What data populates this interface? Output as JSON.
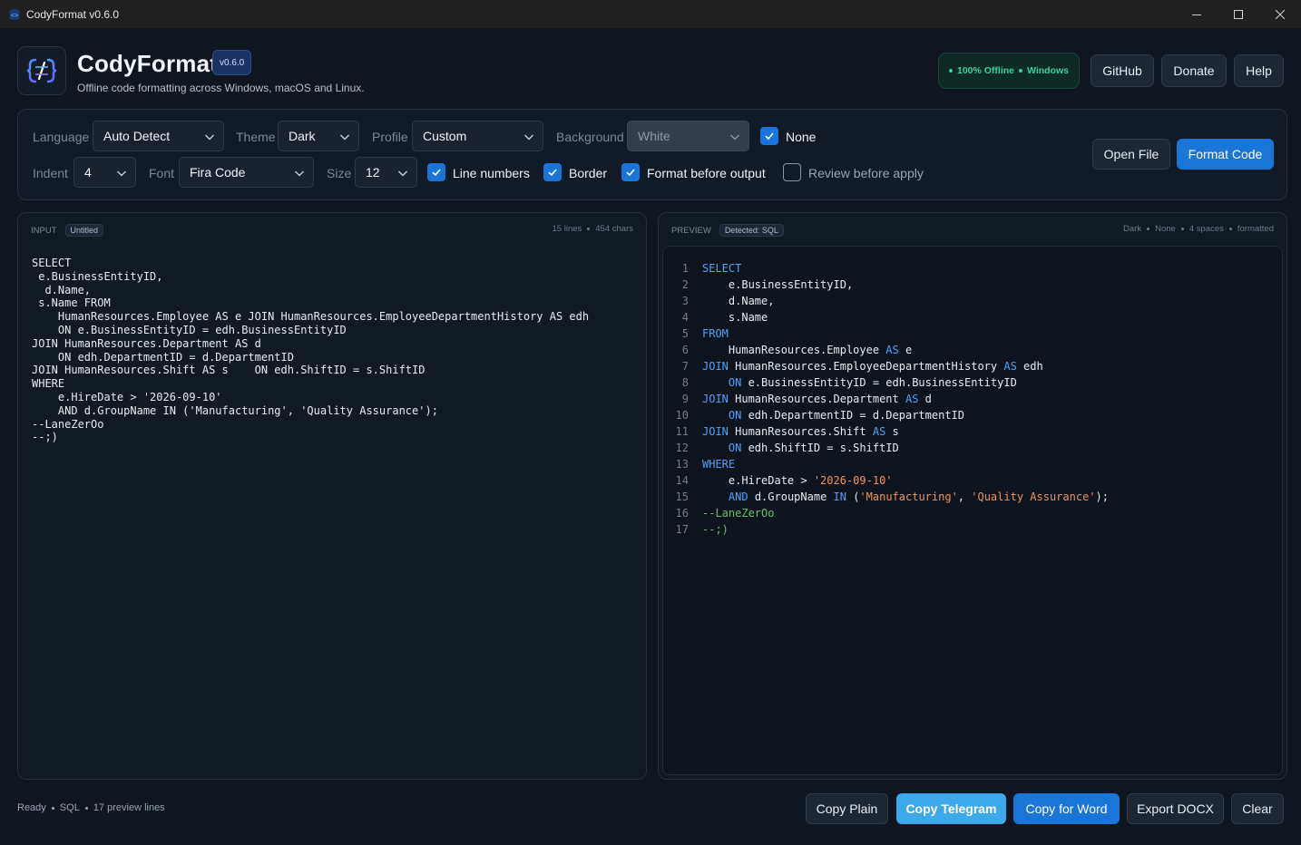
{
  "window": {
    "title": "CodyFormat v0.6.0"
  },
  "header": {
    "brand": "CodyFormat",
    "version": "v0.6.0",
    "subtitle": "Offline code formatting across Windows, macOS and Linux.",
    "status_offline": "100% Offline",
    "status_os": "Windows",
    "buttons": {
      "github": "GitHub",
      "donate": "Donate",
      "help": "Help"
    }
  },
  "options": {
    "language_label": "Language",
    "language_value": "Auto Detect",
    "theme_label": "Theme",
    "theme_value": "Dark",
    "profile_label": "Profile",
    "profile_value": "Custom",
    "background_label": "Background",
    "background_value": "White",
    "none_label": "None",
    "none_checked": true,
    "indent_label": "Indent",
    "indent_value": "4",
    "font_label": "Font",
    "font_value": "Fira Code",
    "size_label": "Size",
    "size_value": "12",
    "line_numbers_label": "Line numbers",
    "line_numbers_checked": true,
    "border_label": "Border",
    "border_checked": true,
    "format_before_output_label": "Format before output",
    "format_before_output_checked": true,
    "review_before_apply_label": "Review before apply",
    "review_before_apply_checked": false,
    "open_file": "Open File",
    "format_code": "Format Code"
  },
  "input": {
    "label": "INPUT",
    "tag": "Untitled",
    "lines": "15 lines",
    "chars": "454 chars",
    "code": "SELECT\n e.BusinessEntityID,\n  d.Name,\n s.Name FROM\n    HumanResources.Employee AS e JOIN HumanResources.EmployeeDepartmentHistory AS edh\n    ON e.BusinessEntityID = edh.BusinessEntityID\nJOIN HumanResources.Department AS d\n    ON edh.DepartmentID = d.DepartmentID\nJOIN HumanResources.Shift AS s    ON edh.ShiftID = s.ShiftID\nWHERE\n    e.HireDate > '2026-09-10'\n    AND d.GroupName IN ('Manufacturing', 'Quality Assurance');\n--LaneZerOo\n--;)"
  },
  "preview": {
    "label": "PREVIEW",
    "tag": "Detected: SQL",
    "meta": [
      "Dark",
      "None",
      "4 spaces",
      "formatted"
    ],
    "lines": [
      [
        {
          "t": "SELECT",
          "c": "kw"
        }
      ],
      [
        {
          "t": "    e.BusinessEntityID,",
          "c": "idt"
        }
      ],
      [
        {
          "t": "    d.Name,",
          "c": "idt"
        }
      ],
      [
        {
          "t": "    s.Name",
          "c": "idt"
        }
      ],
      [
        {
          "t": "FROM",
          "c": "kw"
        }
      ],
      [
        {
          "t": "    HumanResources.Employee ",
          "c": "idt"
        },
        {
          "t": "AS",
          "c": "kw"
        },
        {
          "t": " e",
          "c": "idt"
        }
      ],
      [
        {
          "t": "JOIN",
          "c": "kw"
        },
        {
          "t": " HumanResources.EmployeeDepartmentHistory ",
          "c": "idt"
        },
        {
          "t": "AS",
          "c": "kw"
        },
        {
          "t": " edh",
          "c": "idt"
        }
      ],
      [
        {
          "t": "    ",
          "c": "idt"
        },
        {
          "t": "ON",
          "c": "kw"
        },
        {
          "t": " e.BusinessEntityID = edh.BusinessEntityID",
          "c": "idt"
        }
      ],
      [
        {
          "t": "JOIN",
          "c": "kw"
        },
        {
          "t": " HumanResources.Department ",
          "c": "idt"
        },
        {
          "t": "AS",
          "c": "kw"
        },
        {
          "t": " d",
          "c": "idt"
        }
      ],
      [
        {
          "t": "    ",
          "c": "idt"
        },
        {
          "t": "ON",
          "c": "kw"
        },
        {
          "t": " edh.DepartmentID = d.DepartmentID",
          "c": "idt"
        }
      ],
      [
        {
          "t": "JOIN",
          "c": "kw"
        },
        {
          "t": " HumanResources.Shift ",
          "c": "idt"
        },
        {
          "t": "AS",
          "c": "kw"
        },
        {
          "t": " s",
          "c": "idt"
        }
      ],
      [
        {
          "t": "    ",
          "c": "idt"
        },
        {
          "t": "ON",
          "c": "kw"
        },
        {
          "t": " edh.ShiftID = s.ShiftID",
          "c": "idt"
        }
      ],
      [
        {
          "t": "WHERE",
          "c": "kw"
        }
      ],
      [
        {
          "t": "    e.HireDate > ",
          "c": "idt"
        },
        {
          "t": "'2026-09-10'",
          "c": "str"
        }
      ],
      [
        {
          "t": "    ",
          "c": "idt"
        },
        {
          "t": "AND",
          "c": "kw"
        },
        {
          "t": " d.GroupName ",
          "c": "idt"
        },
        {
          "t": "IN",
          "c": "kw"
        },
        {
          "t": " (",
          "c": "idt"
        },
        {
          "t": "'Manufacturing'",
          "c": "str"
        },
        {
          "t": ", ",
          "c": "idt"
        },
        {
          "t": "'Quality Assurance'",
          "c": "str"
        },
        {
          "t": ");",
          "c": "idt"
        }
      ],
      [
        {
          "t": "--LaneZerOo",
          "c": "cmt"
        }
      ],
      [
        {
          "t": "--;)",
          "c": "cmt"
        }
      ]
    ]
  },
  "footer": {
    "status": "Ready",
    "language": "SQL",
    "preview_lines": "17 preview lines",
    "buttons": {
      "copy_plain": "Copy Plain",
      "copy_telegram": "Copy Telegram",
      "copy_word": "Copy for Word",
      "export_docx": "Export DOCX",
      "clear": "Clear"
    }
  },
  "colors": {
    "accent": "#1a75d8",
    "accent_light": "#3da9ec",
    "keyword": "#4ea1ff",
    "string": "#f2935c",
    "comment": "#6abf69",
    "status_green": "#34d399"
  },
  "icons": [
    "app-logo-icon",
    "minimize-icon",
    "maximize-icon",
    "close-icon",
    "chevron-down-icon",
    "checkmark-icon"
  ]
}
